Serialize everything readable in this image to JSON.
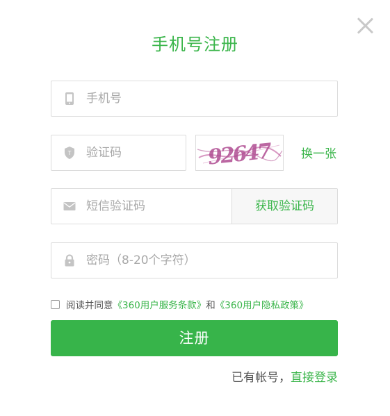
{
  "dialog": {
    "title": "手机号注册",
    "close_icon": "close-icon"
  },
  "form": {
    "phone": {
      "placeholder": "手机号",
      "icon": "mobile-phone-icon"
    },
    "captcha": {
      "placeholder": "验证码",
      "icon": "shield-icon",
      "image_text": "92647",
      "refresh_label": "换一张"
    },
    "sms": {
      "placeholder": "短信验证码",
      "icon": "envelope-icon",
      "button_label": "获取验证码"
    },
    "password": {
      "placeholder": "密码（8-20个字符）",
      "icon": "lock-icon"
    },
    "agreement": {
      "prefix": "阅读并同意",
      "terms_link": "《360用户服务条款》",
      "conjunction": "和",
      "privacy_link": "《360用户隐私政策》",
      "checked": false
    },
    "submit_label": "注册",
    "login_prompt": "已有帐号，",
    "login_link": "直接登录"
  },
  "colors": {
    "accent": "#3ab54a",
    "button": "#37b44a",
    "border": "#dcdcdc",
    "placeholder": "#a8a8a8"
  }
}
